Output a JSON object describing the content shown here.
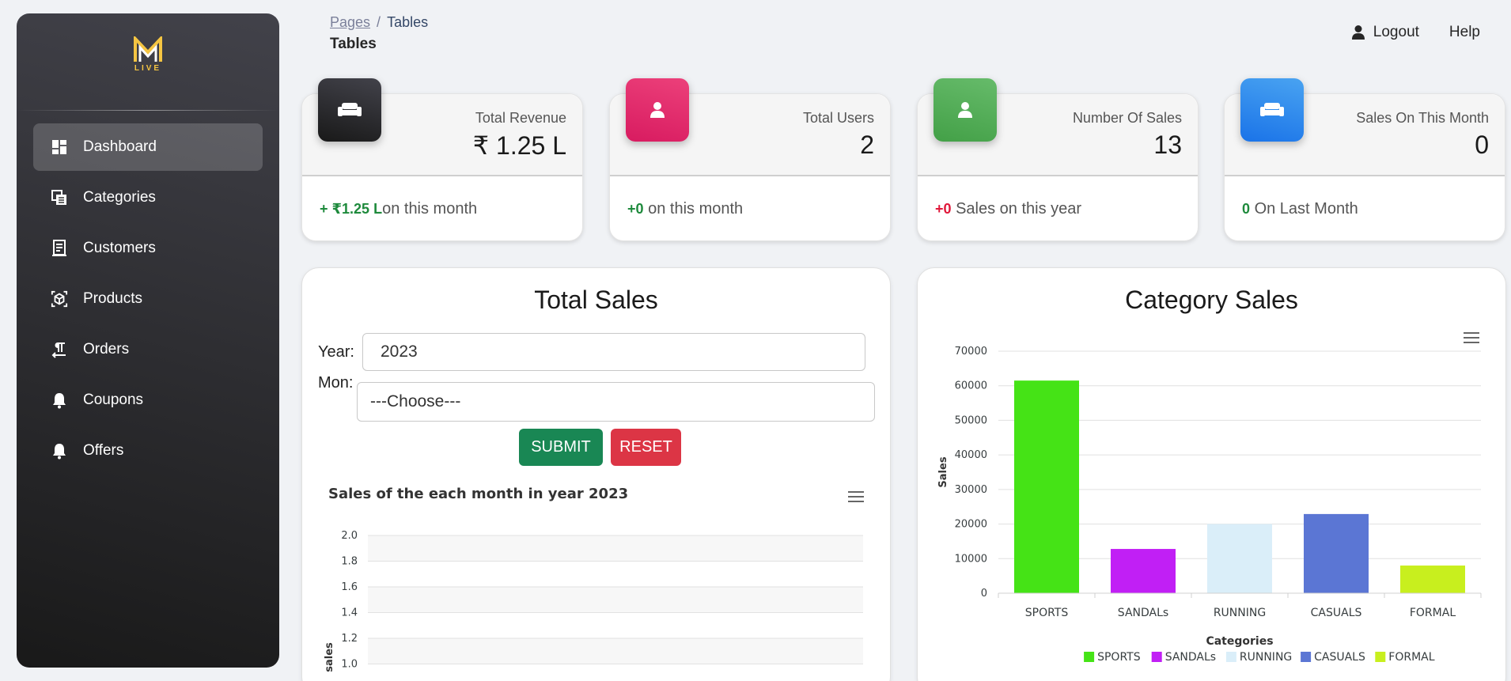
{
  "brand": {
    "logo_text": "M",
    "sub": "LIVE",
    "accent": "#f5c542"
  },
  "sidebar": {
    "items": [
      {
        "label": "Dashboard",
        "icon": "dashboard-icon",
        "active": true
      },
      {
        "label": "Categories",
        "icon": "categories-icon"
      },
      {
        "label": "Customers",
        "icon": "customers-icon"
      },
      {
        "label": "Products",
        "icon": "products-icon"
      },
      {
        "label": "Orders",
        "icon": "orders-icon"
      },
      {
        "label": "Coupons",
        "icon": "bell-icon"
      },
      {
        "label": "Offers",
        "icon": "bell-icon"
      }
    ]
  },
  "topbar": {
    "breadcrumb_root": "Pages",
    "breadcrumb_sep": "/",
    "breadcrumb_current": "Tables",
    "title": "Tables",
    "logout": "Logout",
    "help": "Help"
  },
  "stats": [
    {
      "label": "Total Revenue",
      "value": "₹ 1.25 L",
      "delta": "+ ₹1.25 L",
      "note": "on this month",
      "delta_color": "green",
      "icon": "sofa-icon",
      "icon_bg": "#262626"
    },
    {
      "label": "Total Users",
      "value": "2",
      "delta": "+0",
      "note": " on this month",
      "delta_color": "green",
      "icon": "user-icon",
      "icon_bg": "#e91e63"
    },
    {
      "label": "Number Of Sales",
      "value": "13",
      "delta": "+0",
      "note": " Sales on this year",
      "delta_color": "red",
      "icon": "user-icon",
      "icon_bg": "#4caf50"
    },
    {
      "label": "Sales On This Month",
      "value": "0",
      "delta": "0",
      "note": " On Last Month",
      "delta_color": "green",
      "icon": "sofa-icon",
      "icon_bg": "#1a73e8"
    }
  ],
  "total_sales": {
    "title": "Total Sales",
    "year_label": "Year:",
    "year_value": "2023",
    "month_label": "Mon:",
    "month_value": "---Choose---",
    "submit": "SUBMIT",
    "reset": "RESET",
    "chart_title": "Sales of the each month in year 2023"
  },
  "category_sales": {
    "title": "Category Sales"
  },
  "chart_data": [
    {
      "type": "line",
      "title": "Sales of the each month in year 2023",
      "ylabel": "sales",
      "y_ticks": [
        "2.0",
        "1.8",
        "1.6",
        "1.4",
        "1.2",
        "1.0"
      ],
      "ylim": [
        1.0,
        2.0
      ],
      "series": []
    },
    {
      "type": "bar",
      "categories": [
        "SPORTS",
        "SANDALs",
        "RUNNING",
        "CASUALS",
        "FORMAL"
      ],
      "values": [
        61500,
        12800,
        20000,
        22900,
        8000
      ],
      "colors": [
        "#45e316",
        "#c11ff5",
        "#daeef9",
        "#5b76d4",
        "#c8ef1e"
      ],
      "xlabel": "Categories",
      "ylabel": "Sales",
      "ylim": [
        0,
        70000
      ],
      "y_ticks": [
        0,
        10000,
        20000,
        30000,
        40000,
        50000,
        60000,
        70000
      ],
      "legend": "bottom",
      "grid": true
    }
  ]
}
